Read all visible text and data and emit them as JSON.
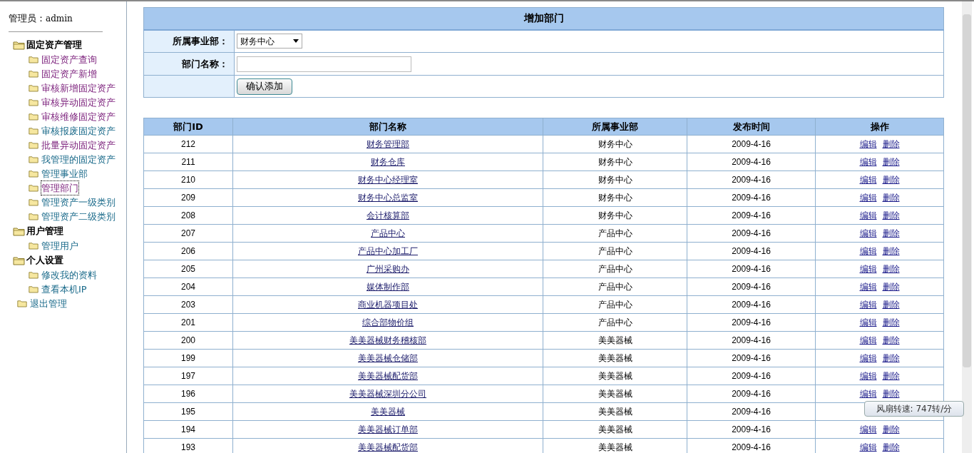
{
  "sidebar": {
    "admin_label": "管理员：",
    "admin_name": "admin",
    "groups": [
      {
        "title": "固定资产管理",
        "items": [
          {
            "label": "固定资产查询",
            "visited": true,
            "selected": false
          },
          {
            "label": "固定资产新增",
            "visited": true,
            "selected": false
          },
          {
            "label": "审核新增固定资产",
            "visited": true,
            "selected": false
          },
          {
            "label": "审核异动固定资产",
            "visited": true,
            "selected": false
          },
          {
            "label": "审核维修固定资产",
            "visited": true,
            "selected": false
          },
          {
            "label": "审核报废固定资产",
            "visited": false,
            "selected": false
          },
          {
            "label": "批量异动固定资产",
            "visited": true,
            "selected": false
          },
          {
            "label": "我管理的固定资产",
            "visited": false,
            "selected": false
          },
          {
            "label": "管理事业部",
            "visited": false,
            "selected": false
          },
          {
            "label": "管理部门",
            "visited": true,
            "selected": true
          },
          {
            "label": "管理资产一级类别",
            "visited": false,
            "selected": false
          },
          {
            "label": "管理资产二级类别",
            "visited": false,
            "selected": false
          }
        ]
      },
      {
        "title": "用户管理",
        "items": [
          {
            "label": "管理用户",
            "visited": false,
            "selected": false
          }
        ]
      },
      {
        "title": "个人设置",
        "items": [
          {
            "label": "修改我的资料",
            "visited": false,
            "selected": false
          },
          {
            "label": "查看本机IP",
            "visited": false,
            "selected": false
          }
        ]
      }
    ],
    "logout": "退出管理"
  },
  "form": {
    "title": "增加部门",
    "division_label": "所属事业部：",
    "division_value": "财务中心",
    "name_label": "部门名称：",
    "submit": "确认添加"
  },
  "table": {
    "columns": [
      "部门ID",
      "部门名称",
      "所属事业部",
      "发布时间",
      "操作"
    ],
    "rows": [
      {
        "id": "212",
        "name": "财务管理部",
        "division": "财务中心",
        "date": "2009-4-16",
        "actions": [
          "编辑",
          "删除"
        ]
      },
      {
        "id": "211",
        "name": "财务仓库",
        "division": "财务中心",
        "date": "2009-4-16",
        "actions": [
          "编辑",
          "删除"
        ]
      },
      {
        "id": "210",
        "name": "财务中心经理室",
        "division": "财务中心",
        "date": "2009-4-16",
        "actions": [
          "编辑",
          "删除"
        ]
      },
      {
        "id": "209",
        "name": "财务中心总监室",
        "division": "财务中心",
        "date": "2009-4-16",
        "actions": [
          "编辑",
          "删除"
        ]
      },
      {
        "id": "208",
        "name": "会计核算部",
        "division": "财务中心",
        "date": "2009-4-16",
        "actions": [
          "编辑",
          "删除"
        ]
      },
      {
        "id": "207",
        "name": "产品中心",
        "division": "产品中心",
        "date": "2009-4-16",
        "actions": [
          "编辑",
          "删除"
        ]
      },
      {
        "id": "206",
        "name": "产品中心加工厂",
        "division": "产品中心",
        "date": "2009-4-16",
        "actions": [
          "编辑",
          "删除"
        ]
      },
      {
        "id": "205",
        "name": "广州采购办",
        "division": "产品中心",
        "date": "2009-4-16",
        "actions": [
          "编辑",
          "删除"
        ]
      },
      {
        "id": "204",
        "name": "媒体制作部",
        "division": "产品中心",
        "date": "2009-4-16",
        "actions": [
          "编辑",
          "删除"
        ]
      },
      {
        "id": "203",
        "name": "商业机器项目处",
        "division": "产品中心",
        "date": "2009-4-16",
        "actions": [
          "编辑",
          "删除"
        ]
      },
      {
        "id": "201",
        "name": "综合部物价组",
        "division": "产品中心",
        "date": "2009-4-16",
        "actions": [
          "编辑",
          "删除"
        ]
      },
      {
        "id": "200",
        "name": "美美器械财务稽核部",
        "division": "美美器械",
        "date": "2009-4-16",
        "actions": [
          "编辑",
          "删除"
        ]
      },
      {
        "id": "199",
        "name": "美美器械仓储部",
        "division": "美美器械",
        "date": "2009-4-16",
        "actions": [
          "编辑",
          "删除"
        ]
      },
      {
        "id": "197",
        "name": "美美器械配货部",
        "division": "美美器械",
        "date": "2009-4-16",
        "actions": [
          "编辑",
          "删除"
        ]
      },
      {
        "id": "196",
        "name": "美美器械深圳分公司",
        "division": "美美器械",
        "date": "2009-4-16",
        "actions": [
          "编辑",
          "删除"
        ]
      },
      {
        "id": "195",
        "name": "美美器械",
        "division": "美美器械",
        "date": "2009-4-16"
      },
      {
        "id": "194",
        "name": "美美器械订单部",
        "division": "美美器械",
        "date": "2009-4-16",
        "actions": [
          "编辑",
          "删除"
        ]
      },
      {
        "id": "193",
        "name": "美美器械配货部",
        "division": "美美器械",
        "date": "2009-4-16",
        "actions": [
          "编辑",
          "删除"
        ]
      }
    ]
  },
  "tooltip": {
    "text": "风扇转速: 747转/分"
  }
}
